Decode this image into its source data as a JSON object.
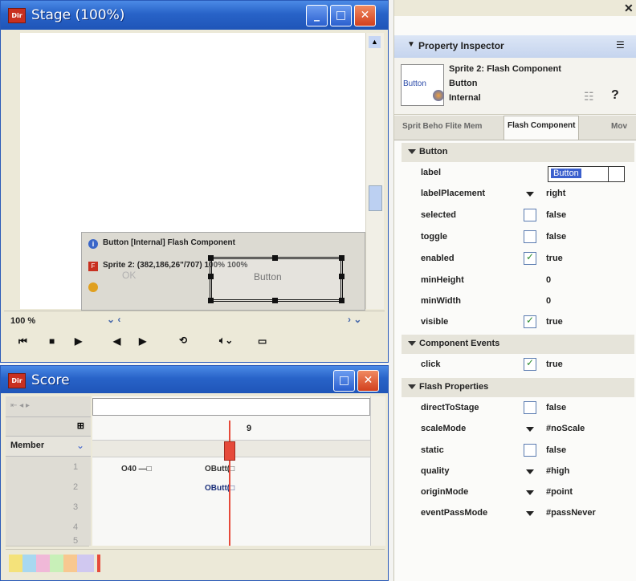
{
  "stage": {
    "title": "Stage (100%)",
    "zoom": "100 %",
    "info_line1": "Button [Internal] Flash Component",
    "info_line2": "Sprite 2: (382,186,26\"/707) 100% 100%",
    "ok_text": "OK",
    "button_text": "Button"
  },
  "score": {
    "title": "Score",
    "member_label": "Member",
    "channel_numbers": [
      "1",
      "2",
      "3",
      "4",
      "5"
    ],
    "frame_marker": "9",
    "sprite1_text": "O40 —□",
    "sprite2_text": "OButt(□",
    "sprite3_text": "OButt(□"
  },
  "inspector": {
    "title": "Property Inspector",
    "sprite_name": "Sprite 2: Flash Component",
    "thumb_text": "Button",
    "member_name": "Button",
    "member_type": "Internal",
    "tabs": [
      "Sprit Beho Flite Mem",
      "Flash Component",
      "Mov"
    ],
    "sections": {
      "button": "Button",
      "events": "Component Events",
      "flash": "Flash Properties"
    },
    "button_props": [
      {
        "name": "label",
        "value": "Button",
        "kind": "text"
      },
      {
        "name": "labelPlacement",
        "value": "right",
        "kind": "dropdown"
      },
      {
        "name": "selected",
        "value": "false",
        "kind": "check",
        "checked": false
      },
      {
        "name": "toggle",
        "value": "false",
        "kind": "check",
        "checked": false
      },
      {
        "name": "enabled",
        "value": "true",
        "kind": "check",
        "checked": true
      },
      {
        "name": "minHeight",
        "value": "0",
        "kind": "number"
      },
      {
        "name": "minWidth",
        "value": "0",
        "kind": "number"
      },
      {
        "name": "visible",
        "value": "true",
        "kind": "check",
        "checked": true
      }
    ],
    "event_props": [
      {
        "name": "click",
        "value": "true",
        "kind": "check",
        "checked": true
      }
    ],
    "flash_props": [
      {
        "name": "directToStage",
        "value": "false",
        "kind": "check",
        "checked": false
      },
      {
        "name": "scaleMode",
        "value": "#noScale",
        "kind": "dropdown"
      },
      {
        "name": "static",
        "value": "false",
        "kind": "check",
        "checked": false
      },
      {
        "name": "quality",
        "value": "#high",
        "kind": "dropdown"
      },
      {
        "name": "originMode",
        "value": "#point",
        "kind": "dropdown"
      },
      {
        "name": "eventPassMode",
        "value": "#passNever",
        "kind": "dropdown"
      }
    ]
  },
  "colors": {
    "titlebar": "#2863c8",
    "close": "#d2401e",
    "playhead": "#e64a3a",
    "selection": "#3a5fcd"
  }
}
